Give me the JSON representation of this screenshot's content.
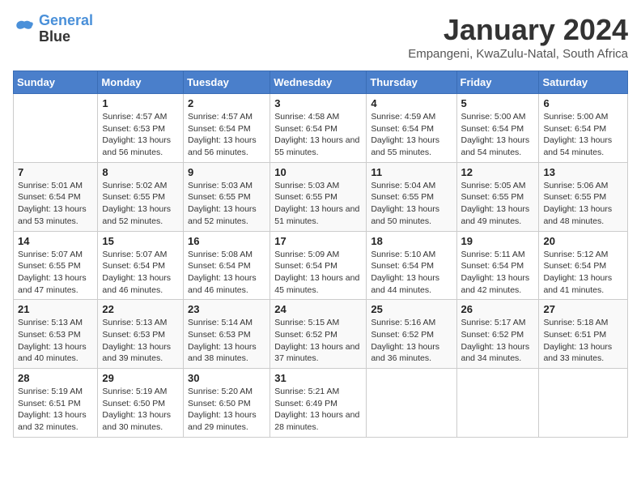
{
  "header": {
    "logo_line1": "General",
    "logo_line2": "Blue",
    "month_title": "January 2024",
    "subtitle": "Empangeni, KwaZulu-Natal, South Africa"
  },
  "days_of_week": [
    "Sunday",
    "Monday",
    "Tuesday",
    "Wednesday",
    "Thursday",
    "Friday",
    "Saturday"
  ],
  "weeks": [
    [
      {
        "num": "",
        "sunrise": "",
        "sunset": "",
        "daylight": ""
      },
      {
        "num": "1",
        "sunrise": "Sunrise: 4:57 AM",
        "sunset": "Sunset: 6:53 PM",
        "daylight": "Daylight: 13 hours and 56 minutes."
      },
      {
        "num": "2",
        "sunrise": "Sunrise: 4:57 AM",
        "sunset": "Sunset: 6:54 PM",
        "daylight": "Daylight: 13 hours and 56 minutes."
      },
      {
        "num": "3",
        "sunrise": "Sunrise: 4:58 AM",
        "sunset": "Sunset: 6:54 PM",
        "daylight": "Daylight: 13 hours and 55 minutes."
      },
      {
        "num": "4",
        "sunrise": "Sunrise: 4:59 AM",
        "sunset": "Sunset: 6:54 PM",
        "daylight": "Daylight: 13 hours and 55 minutes."
      },
      {
        "num": "5",
        "sunrise": "Sunrise: 5:00 AM",
        "sunset": "Sunset: 6:54 PM",
        "daylight": "Daylight: 13 hours and 54 minutes."
      },
      {
        "num": "6",
        "sunrise": "Sunrise: 5:00 AM",
        "sunset": "Sunset: 6:54 PM",
        "daylight": "Daylight: 13 hours and 54 minutes."
      }
    ],
    [
      {
        "num": "7",
        "sunrise": "Sunrise: 5:01 AM",
        "sunset": "Sunset: 6:54 PM",
        "daylight": "Daylight: 13 hours and 53 minutes."
      },
      {
        "num": "8",
        "sunrise": "Sunrise: 5:02 AM",
        "sunset": "Sunset: 6:55 PM",
        "daylight": "Daylight: 13 hours and 52 minutes."
      },
      {
        "num": "9",
        "sunrise": "Sunrise: 5:03 AM",
        "sunset": "Sunset: 6:55 PM",
        "daylight": "Daylight: 13 hours and 52 minutes."
      },
      {
        "num": "10",
        "sunrise": "Sunrise: 5:03 AM",
        "sunset": "Sunset: 6:55 PM",
        "daylight": "Daylight: 13 hours and 51 minutes."
      },
      {
        "num": "11",
        "sunrise": "Sunrise: 5:04 AM",
        "sunset": "Sunset: 6:55 PM",
        "daylight": "Daylight: 13 hours and 50 minutes."
      },
      {
        "num": "12",
        "sunrise": "Sunrise: 5:05 AM",
        "sunset": "Sunset: 6:55 PM",
        "daylight": "Daylight: 13 hours and 49 minutes."
      },
      {
        "num": "13",
        "sunrise": "Sunrise: 5:06 AM",
        "sunset": "Sunset: 6:55 PM",
        "daylight": "Daylight: 13 hours and 48 minutes."
      }
    ],
    [
      {
        "num": "14",
        "sunrise": "Sunrise: 5:07 AM",
        "sunset": "Sunset: 6:55 PM",
        "daylight": "Daylight: 13 hours and 47 minutes."
      },
      {
        "num": "15",
        "sunrise": "Sunrise: 5:07 AM",
        "sunset": "Sunset: 6:54 PM",
        "daylight": "Daylight: 13 hours and 46 minutes."
      },
      {
        "num": "16",
        "sunrise": "Sunrise: 5:08 AM",
        "sunset": "Sunset: 6:54 PM",
        "daylight": "Daylight: 13 hours and 46 minutes."
      },
      {
        "num": "17",
        "sunrise": "Sunrise: 5:09 AM",
        "sunset": "Sunset: 6:54 PM",
        "daylight": "Daylight: 13 hours and 45 minutes."
      },
      {
        "num": "18",
        "sunrise": "Sunrise: 5:10 AM",
        "sunset": "Sunset: 6:54 PM",
        "daylight": "Daylight: 13 hours and 44 minutes."
      },
      {
        "num": "19",
        "sunrise": "Sunrise: 5:11 AM",
        "sunset": "Sunset: 6:54 PM",
        "daylight": "Daylight: 13 hours and 42 minutes."
      },
      {
        "num": "20",
        "sunrise": "Sunrise: 5:12 AM",
        "sunset": "Sunset: 6:54 PM",
        "daylight": "Daylight: 13 hours and 41 minutes."
      }
    ],
    [
      {
        "num": "21",
        "sunrise": "Sunrise: 5:13 AM",
        "sunset": "Sunset: 6:53 PM",
        "daylight": "Daylight: 13 hours and 40 minutes."
      },
      {
        "num": "22",
        "sunrise": "Sunrise: 5:13 AM",
        "sunset": "Sunset: 6:53 PM",
        "daylight": "Daylight: 13 hours and 39 minutes."
      },
      {
        "num": "23",
        "sunrise": "Sunrise: 5:14 AM",
        "sunset": "Sunset: 6:53 PM",
        "daylight": "Daylight: 13 hours and 38 minutes."
      },
      {
        "num": "24",
        "sunrise": "Sunrise: 5:15 AM",
        "sunset": "Sunset: 6:52 PM",
        "daylight": "Daylight: 13 hours and 37 minutes."
      },
      {
        "num": "25",
        "sunrise": "Sunrise: 5:16 AM",
        "sunset": "Sunset: 6:52 PM",
        "daylight": "Daylight: 13 hours and 36 minutes."
      },
      {
        "num": "26",
        "sunrise": "Sunrise: 5:17 AM",
        "sunset": "Sunset: 6:52 PM",
        "daylight": "Daylight: 13 hours and 34 minutes."
      },
      {
        "num": "27",
        "sunrise": "Sunrise: 5:18 AM",
        "sunset": "Sunset: 6:51 PM",
        "daylight": "Daylight: 13 hours and 33 minutes."
      }
    ],
    [
      {
        "num": "28",
        "sunrise": "Sunrise: 5:19 AM",
        "sunset": "Sunset: 6:51 PM",
        "daylight": "Daylight: 13 hours and 32 minutes."
      },
      {
        "num": "29",
        "sunrise": "Sunrise: 5:19 AM",
        "sunset": "Sunset: 6:50 PM",
        "daylight": "Daylight: 13 hours and 30 minutes."
      },
      {
        "num": "30",
        "sunrise": "Sunrise: 5:20 AM",
        "sunset": "Sunset: 6:50 PM",
        "daylight": "Daylight: 13 hours and 29 minutes."
      },
      {
        "num": "31",
        "sunrise": "Sunrise: 5:21 AM",
        "sunset": "Sunset: 6:49 PM",
        "daylight": "Daylight: 13 hours and 28 minutes."
      },
      {
        "num": "",
        "sunrise": "",
        "sunset": "",
        "daylight": ""
      },
      {
        "num": "",
        "sunrise": "",
        "sunset": "",
        "daylight": ""
      },
      {
        "num": "",
        "sunrise": "",
        "sunset": "",
        "daylight": ""
      }
    ]
  ]
}
